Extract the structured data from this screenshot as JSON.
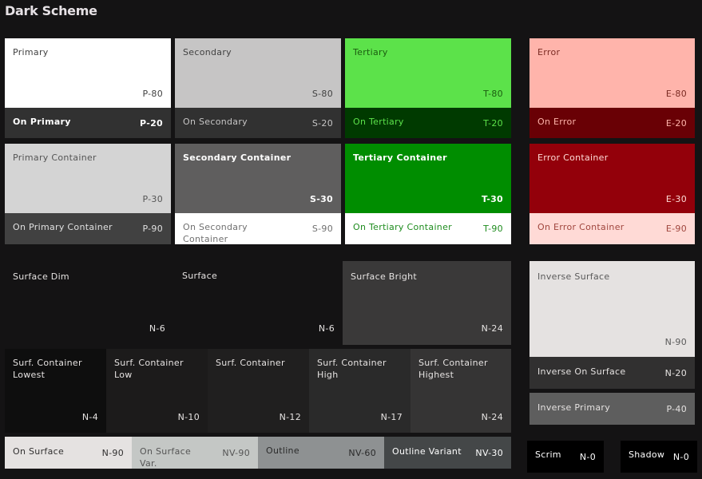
{
  "title": "Dark Scheme",
  "colors": {
    "background": "#141314",
    "primary": "#ffffff",
    "on_primary": "#313131",
    "primary_container": "#d4d4d4",
    "on_primary_container": "#414141",
    "secondary": "#c6c5c5",
    "on_secondary": "#313131",
    "secondary_container": "#5f5e5e",
    "on_secondary_container": "#ffffff",
    "tertiary": "#5ce24a",
    "on_tertiary": "#003a00",
    "tertiary_container": "#008d00",
    "on_tertiary_container": "#ffffff",
    "error": "#ffb4ab",
    "on_error": "#690005",
    "error_container": "#93000a",
    "on_error_container": "#ffdad6",
    "surface": "#141314",
    "surface_bright": "#3a3939",
    "surface_container_lowest": "#0e0e0e",
    "surface_container_low": "#1c1b1b",
    "surface_container": "#201f1f",
    "surface_container_high": "#2a2a2a",
    "surface_container_highest": "#353434",
    "on_surface": "#e5e2e1",
    "on_surface_variant": "#c4c7c5",
    "outline": "#8e9192",
    "outline_variant": "#444748",
    "inverse_surface": "#e5e2e1",
    "inverse_on_surface": "#313030",
    "inverse_primary": "#5e5e5e",
    "scrim": "#000000",
    "shadow": "#000000"
  },
  "tiles": {
    "primary": {
      "label": "Primary",
      "tone": "P-80"
    },
    "on_primary": {
      "label": "On Primary",
      "tone": "P-20"
    },
    "secondary": {
      "label": "Secondary",
      "tone": "S-80"
    },
    "on_secondary": {
      "label": "On Secondary",
      "tone": "S-20"
    },
    "tertiary": {
      "label": "Tertiary",
      "tone": "T-80"
    },
    "on_tertiary": {
      "label": "On Tertiary",
      "tone": "T-20"
    },
    "error": {
      "label": "Error",
      "tone": "E-80"
    },
    "on_error": {
      "label": "On Error",
      "tone": "E-20"
    },
    "primary_container": {
      "label": "Primary Container",
      "tone": "P-30"
    },
    "on_primary_container": {
      "label": "On Primary Container",
      "tone": "P-90"
    },
    "secondary_container": {
      "label": "Secondary Container",
      "tone": "S-30"
    },
    "on_secondary_container": {
      "label": "On Secondary Container",
      "tone": "S-90"
    },
    "tertiary_container": {
      "label": "Tertiary Container",
      "tone": "T-30"
    },
    "on_tertiary_container": {
      "label": "On Tertiary Container",
      "tone": "T-90"
    },
    "error_container": {
      "label": "Error Container",
      "tone": "E-30"
    },
    "on_error_container": {
      "label": "On Error Container",
      "tone": "E-90"
    },
    "surface_dim": {
      "label": "Surface Dim",
      "tone": "N-6"
    },
    "surface": {
      "label": "Surface",
      "tone": "N-6"
    },
    "surface_bright": {
      "label": "Surface Bright",
      "tone": "N-24"
    },
    "surface_container_lowest": {
      "label": "Surf. Container Lowest",
      "tone": "N-4"
    },
    "surface_container_low": {
      "label": "Surf. Container Low",
      "tone": "N-10"
    },
    "surface_container": {
      "label": "Surf. Container",
      "tone": "N-12"
    },
    "surface_container_high": {
      "label": "Surf. Container High",
      "tone": "N-17"
    },
    "surface_container_highest": {
      "label": "Surf. Container Highest",
      "tone": "N-24"
    },
    "on_surface": {
      "label": "On Surface",
      "tone": "N-90"
    },
    "on_surface_variant": {
      "label": "On Surface Var.",
      "tone": "NV-90"
    },
    "outline": {
      "label": "Outline",
      "tone": "NV-60"
    },
    "outline_variant": {
      "label": "Outline Variant",
      "tone": "NV-30"
    },
    "inverse_surface": {
      "label": "Inverse Surface",
      "tone": "N-90"
    },
    "inverse_on_surface": {
      "label": "Inverse On Surface",
      "tone": "N-20"
    },
    "inverse_primary": {
      "label": "Inverse Primary",
      "tone": "P-40"
    },
    "scrim": {
      "label": "Scrim",
      "tone": "N-0"
    },
    "shadow": {
      "label": "Shadow",
      "tone": "N-0"
    }
  }
}
